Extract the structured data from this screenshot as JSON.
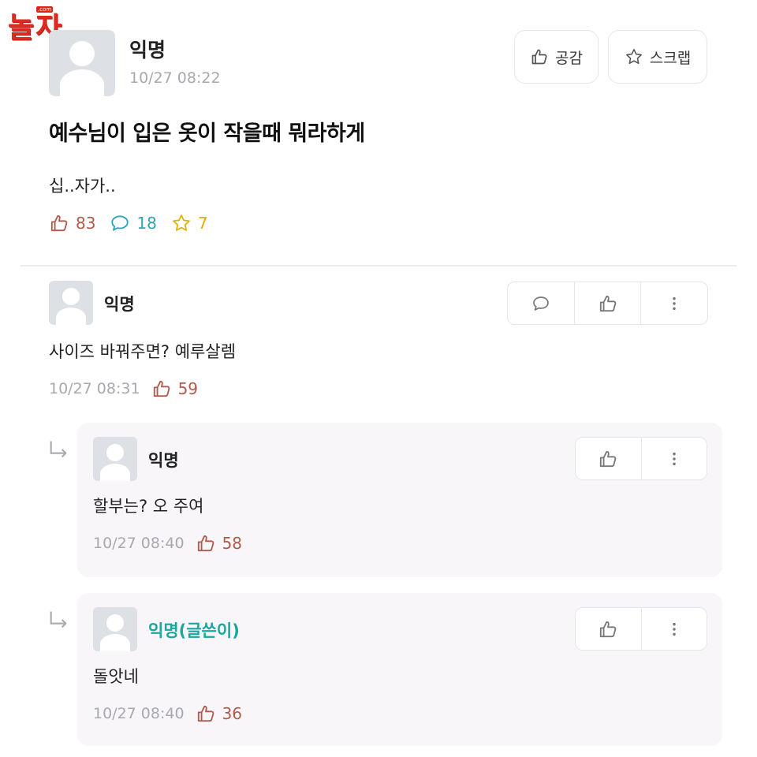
{
  "logo": {
    "text": "놀자",
    "domain": ".com"
  },
  "post": {
    "author": "익명",
    "date": "10/27 08:22",
    "like_button_label": "공감",
    "scrap_button_label": "스크랩",
    "title": "예수님이 입은 옷이 작을때 뭐라하게",
    "body": "십..자가..",
    "stats": {
      "likes": "83",
      "comments": "18",
      "scraps": "7"
    }
  },
  "comments": [
    {
      "author": "익명",
      "text": "사이즈 바꿔주면? 예루살렘",
      "date": "10/27 08:31",
      "likes": "59"
    }
  ],
  "replies": [
    {
      "author": "익명",
      "text": "할부는? 오 주여",
      "date": "10/27 08:40",
      "likes": "58",
      "is_writer": false
    },
    {
      "author": "익명(글쓴이)",
      "text": "돌앗네",
      "date": "10/27 08:40",
      "likes": "36",
      "is_writer": true
    }
  ],
  "colors": {
    "logo": "#e02a20",
    "like": "#b05a4a",
    "comment": "#2ea5b5",
    "scrap": "#e0b000",
    "writer": "#1aa7a0",
    "reply_bg": "#f8f6f9"
  }
}
